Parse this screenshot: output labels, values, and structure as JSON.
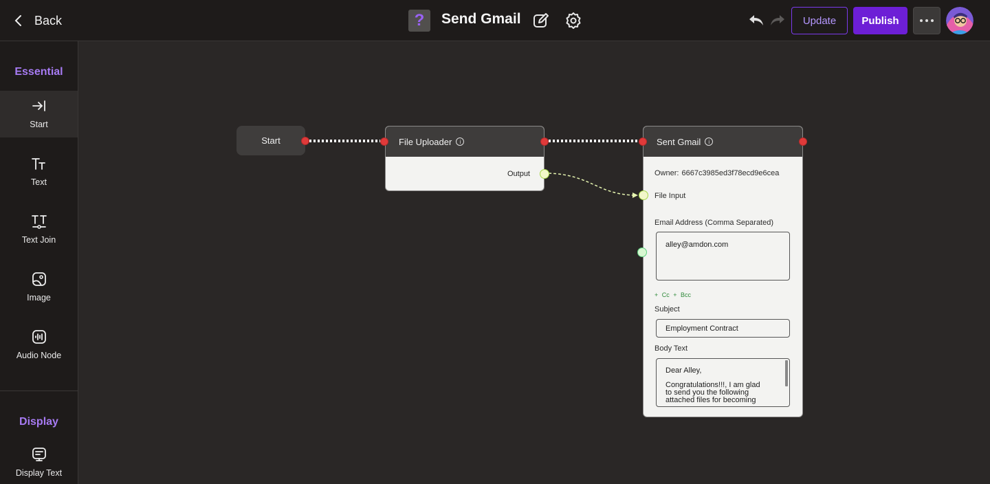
{
  "header": {
    "back_label": "Back",
    "app_icon_glyph": "?",
    "title": "Send Gmail",
    "update_label": "Update",
    "publish_label": "Publish",
    "icons": [
      "chevron-left-icon",
      "edit-icon",
      "gear-icon",
      "undo-icon",
      "redo-icon",
      "more-icon"
    ]
  },
  "sidebar": {
    "essential_title": "Essential",
    "display_title": "Display",
    "items": [
      {
        "label": "Start",
        "icon": "start-arrow-icon"
      },
      {
        "label": "Text",
        "icon": "text-icon"
      },
      {
        "label": "Text Join",
        "icon": "text-join-icon"
      },
      {
        "label": "Image",
        "icon": "image-icon"
      },
      {
        "label": "Audio Node",
        "icon": "audio-icon"
      },
      {
        "label": "Display Text",
        "icon": "display-text-icon"
      }
    ]
  },
  "nodes": {
    "start": {
      "label": "Start"
    },
    "uploader": {
      "title": "File Uploader",
      "output_label": "Output"
    },
    "gmail": {
      "title": "Sent Gmail",
      "owner_label": "Owner:",
      "owner_value": "6667c3985ed3f78ecd9e6cea",
      "file_input_label": "File Input",
      "email_label": "Email Address (Comma Separated)",
      "email_value": "alley@amdon.com",
      "cc_bcc": "+ Cc  + Bcc",
      "subject_label": "Subject",
      "subject_value": "Employment Contract",
      "body_label": "Body Text",
      "body_line1": "Dear Alley,",
      "body_line2": "Congratulations!!!,  I am glad",
      "body_line3": "to send you the following",
      "body_line4": "attached files for becoming"
    }
  },
  "colors": {
    "accent": "#6d1fd6",
    "accent_text": "#a77bf3",
    "port_red": "#e03a3a",
    "port_green": "#5ed07f"
  }
}
